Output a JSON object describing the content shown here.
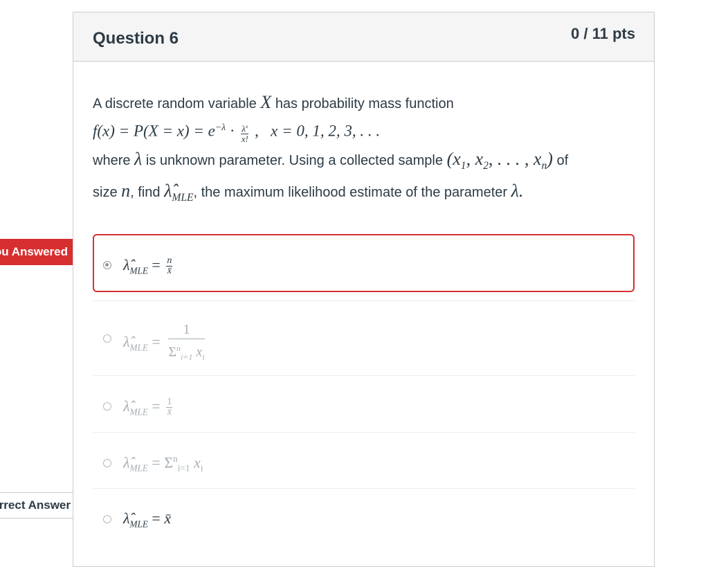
{
  "flags": {
    "you_answered": "You Answered",
    "correct_answer": "Correct Answer"
  },
  "question": {
    "title": "Question 6",
    "points": "0 / 11 pts",
    "intro": "A discrete random variable",
    "intro_var": "X",
    "intro_rest": "has probability mass function",
    "pmf_left": "f(x) = P(X = x) = e",
    "pmf_exp": "−λ",
    "pmf_dot": "·",
    "pmf_num": "λ",
    "pmf_num_sup": "x",
    "pmf_den": "x!",
    "pmf_comma": ",",
    "pmf_domain": "x = 0, 1, 2, 3, . . .",
    "where_1": "where",
    "lambda": "λ",
    "where_2": "is unknown parameter. Using a collected sample",
    "sample": "(x",
    "sample_sub1": "1",
    "sample_mid": ", x",
    "sample_sub2": "2",
    "sample_mid2": ", . . . , x",
    "sample_subn": "n",
    "sample_close": ")",
    "where_3": "of",
    "size_1": "size",
    "n": "n",
    "size_2": ", find",
    "lambda_hat": "λ̂",
    "mle_sub": "MLE",
    "size_3": ", the maximum likelihood estimate of the parameter",
    "period": "λ."
  },
  "answers": [
    {
      "lhs": "λ̂",
      "sub": "MLE",
      "eq": "=",
      "num": "n",
      "den": "x̄",
      "selected": true
    },
    {
      "lhs": "λ̂",
      "sub": "MLE",
      "eq": "=",
      "num": "1",
      "den": "Σ",
      "den_sup": "n",
      "den_sub": "i=1",
      "den_var": "x",
      "den_var_sub": "i",
      "selected": false
    },
    {
      "lhs": "λ̂",
      "sub": "MLE",
      "eq": "=",
      "num": "1",
      "den": "x̄",
      "selected": false
    },
    {
      "lhs": "λ̂",
      "sub": "MLE",
      "eq": "=",
      "sum": "Σ",
      "sum_sup": "n",
      "sum_sub": "i=1",
      "var": "x",
      "var_sub": "i",
      "selected": false
    },
    {
      "lhs": "λ̂",
      "sub": "MLE",
      "eq": "=",
      "rhs": "x̄",
      "selected": false,
      "correct": true
    }
  ]
}
